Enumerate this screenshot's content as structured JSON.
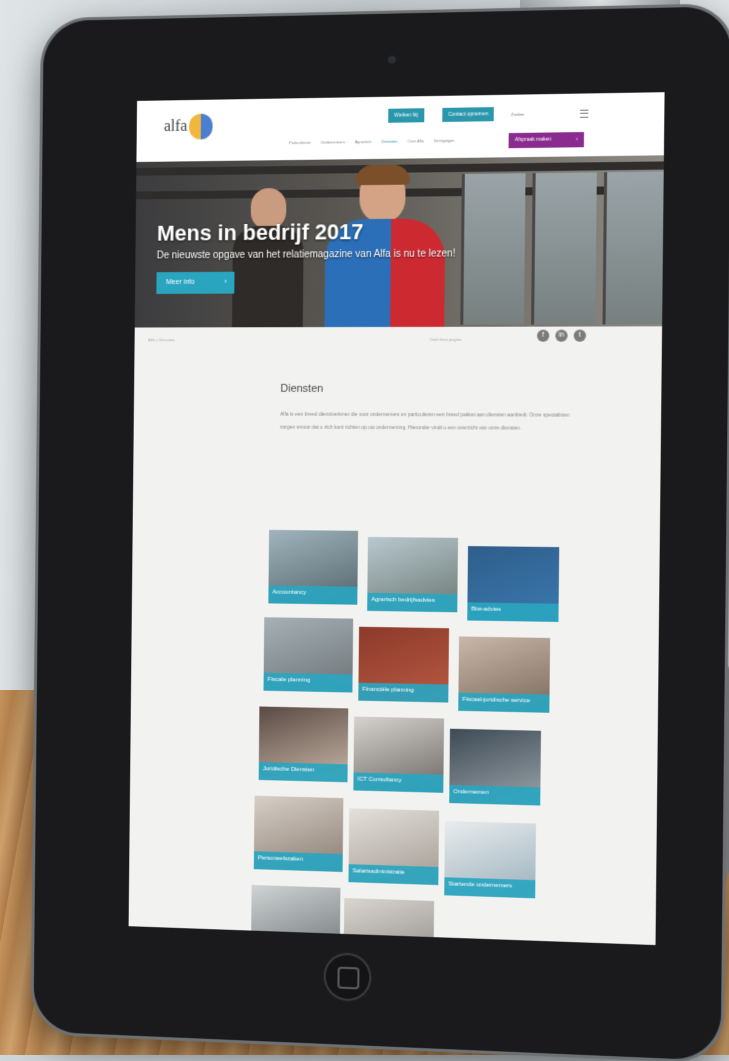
{
  "site": {
    "logo_text": "alfa",
    "top_buttons": [
      "Werken bij",
      "Contact opnemen"
    ],
    "search_label": "Zoeken",
    "nav": [
      "Particulieren",
      "Ondernemers",
      "Agrarisch",
      "Diensten",
      "Over Alfa",
      "Vestigingen"
    ],
    "active_nav_index": 3,
    "cta_button": "Afspraak maken"
  },
  "hero": {
    "title": "Mens in bedrijf 2017",
    "subtitle": "De nieuwste opgave van het relatiemagazine van Alfa is nu te lezen!",
    "button": "Meer info"
  },
  "breadcrumb": "Alfa > Diensten",
  "share_label": "Deel deze pagina",
  "social_icons": [
    "facebook-icon",
    "linkedin-icon",
    "twitter-icon"
  ],
  "content": {
    "title": "Diensten",
    "body": "Alfa is een breed dienstverlener die voor ondernemers en particulieren een breed pakket aan diensten aanbiedt. Onze specialisten zorgen ervoor dat u zich kunt richten op uw onderneming. Hieronder vindt u een overzicht van onze diensten."
  },
  "tiles": [
    {
      "label": "Accountancy"
    },
    {
      "label": "Agrarisch bedrijfsadvies"
    },
    {
      "label": "Btw-advies"
    },
    {
      "label": "Fiscale planning"
    },
    {
      "label": "Financiële planning"
    },
    {
      "label": "Fiscaal-juridische service"
    },
    {
      "label": "Juridische Diensten"
    },
    {
      "label": "ICT Consultancy"
    },
    {
      "label": "Ondernemen"
    },
    {
      "label": "Personeelszaken"
    },
    {
      "label": "Salarisadministratie"
    },
    {
      "label": "Startende ondernemers"
    },
    {
      "label": ""
    },
    {
      "label": ""
    }
  ],
  "colors": {
    "accent": "#2aa5c0",
    "purple": "#8a2c8f",
    "bezel": "#1a1a1c"
  }
}
